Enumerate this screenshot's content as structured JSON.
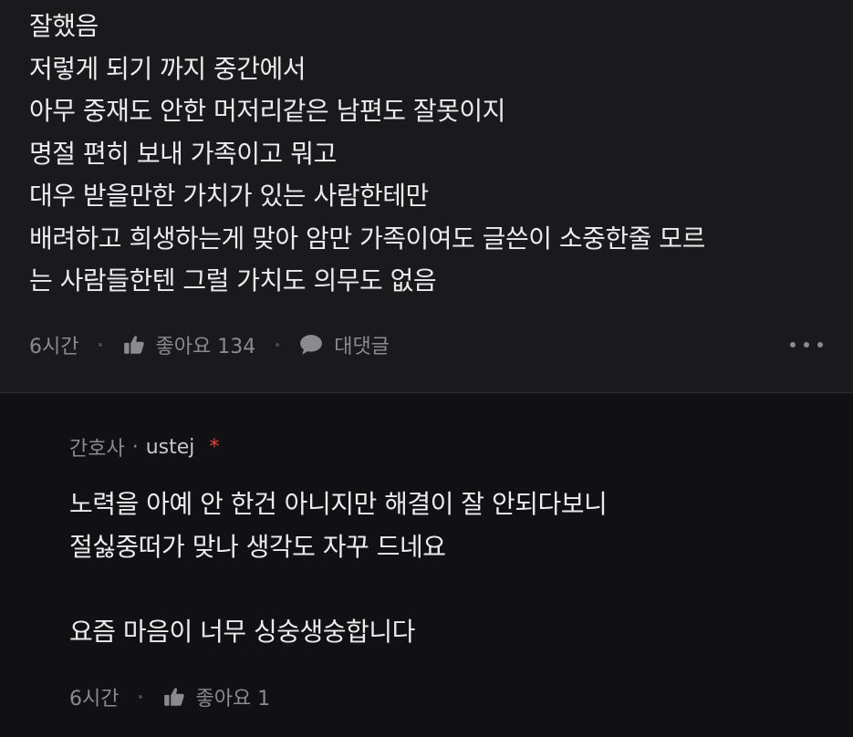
{
  "comment": {
    "lines": [
      "잘했음",
      "저렇게 되기 까지 중간에서",
      "아무 중재도 안한 머저리같은 남편도 잘못이지",
      "명절 편히 보내 가족이고 뭐고",
      "대우 받을만한 가치가 있는 사람한테만",
      "배려하고 희생하는게 맞아 암만 가족이여도 글쓴이 소중한줄 모르",
      "는 사람들한텐 그럴 가치도 의무도 없음"
    ],
    "time": "6시간",
    "like_label": "좋아요 134",
    "reply_label": "대댓글"
  },
  "reply": {
    "category": "간호사",
    "separator": "·",
    "username": "ustej",
    "author_marker": "*",
    "lines": [
      "노력을 아예 안 한건 아니지만 해결이 잘 안되다보니",
      "절싫중떠가 맞나 생각도 자꾸 드네요",
      "",
      "요즘 마음이 너무 싱숭생숭합니다"
    ],
    "time": "6시간",
    "like_label": "좋아요 1"
  },
  "icons": {
    "like": "thumbs-up-icon",
    "reply": "speech-bubble-icon",
    "more": "more-options-icon"
  },
  "colors": {
    "background": "#111113",
    "comment_background": "#1a1a1c",
    "text": "#ececec",
    "muted": "#8b8b8f",
    "author_marker": "#e0453e"
  }
}
